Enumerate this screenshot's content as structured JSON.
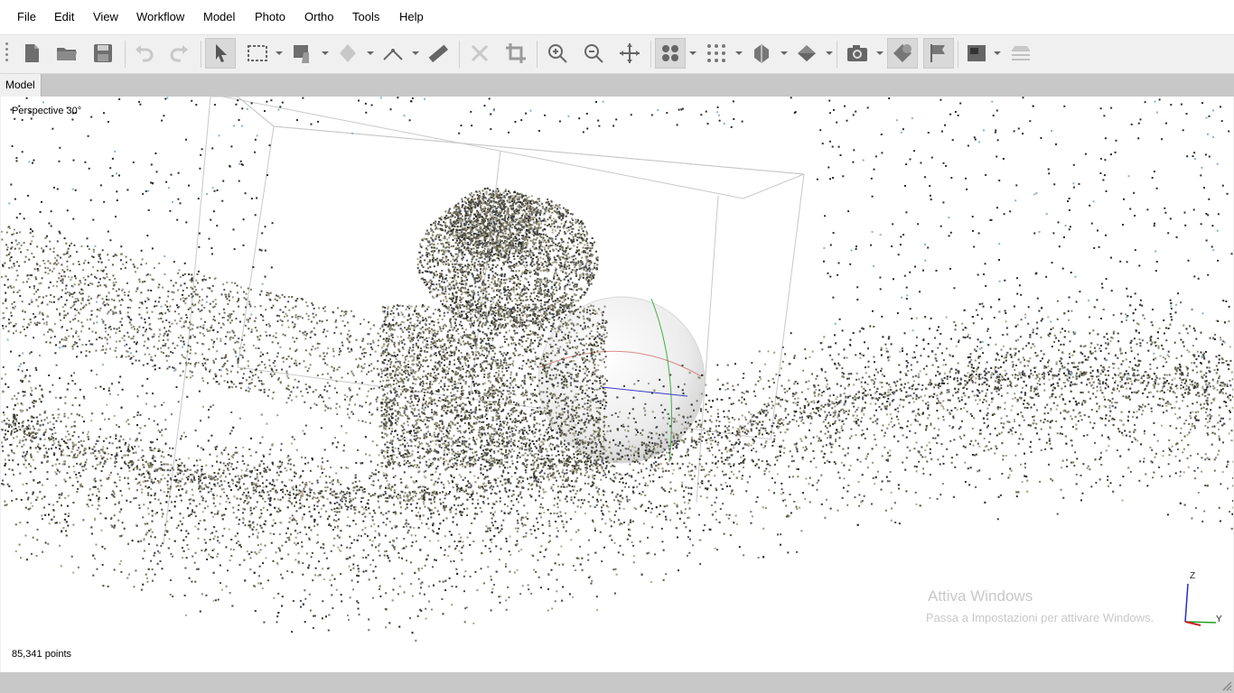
{
  "menu": [
    "File",
    "Edit",
    "View",
    "Workflow",
    "Model",
    "Photo",
    "Ortho",
    "Tools",
    "Help"
  ],
  "toolbar": {
    "icons": [
      "new-document-icon",
      "open-folder-icon",
      "save-icon",
      "undo-icon",
      "redo-icon",
      "select-arrow-icon",
      "rectangle-selection-icon",
      "pan-hand-icon",
      "brush-selection-icon",
      "ruler-point-icon",
      "measure-ruler-icon",
      "delete-icon",
      "crop-icon",
      "zoom-in-icon",
      "zoom-out-icon",
      "move-object-icon",
      "dense-cloud-icon",
      "sparse-points-icon",
      "sphere-shading-icon",
      "shaded-model-icon",
      "camera-icon",
      "orthomosaic-icon",
      "flag-marker-icon",
      "image-preview-icon",
      "layers-icon"
    ]
  },
  "tab": {
    "label": "Model"
  },
  "viewport": {
    "projection": "Perspective 30°",
    "point_count": "85,341 points",
    "axis_z": "Z",
    "axis_y": "Y"
  },
  "watermark": {
    "title": "Attiva Windows",
    "subtitle": "Passa a Impostazioni per attivare Windows."
  },
  "colors": {
    "menubar": "#ffffff",
    "toolbar": "#f0f0f0",
    "tabbar": "#c8c8c8",
    "viewport": "#ffffff"
  }
}
